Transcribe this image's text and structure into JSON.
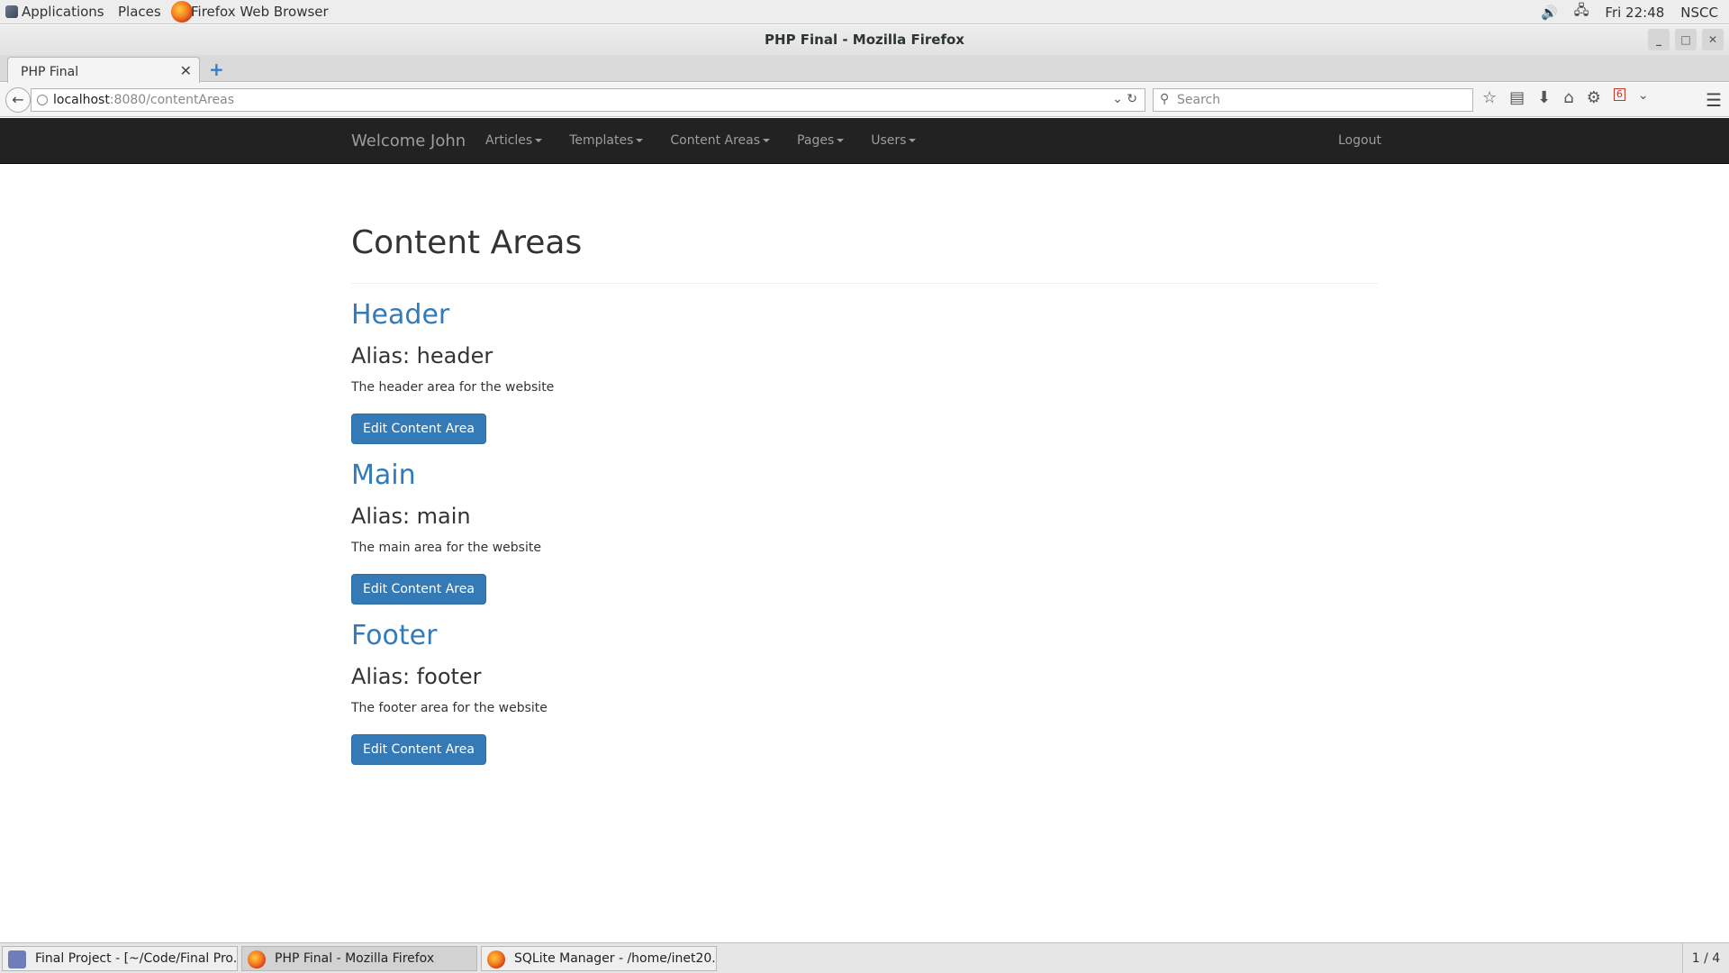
{
  "system_bar": {
    "applications": "Applications",
    "places": "Places",
    "active_app": "Firefox Web Browser",
    "clock": "Fri 22:48",
    "user": "NSCC"
  },
  "window": {
    "title": "PHP Final - Mozilla Firefox"
  },
  "browser": {
    "tab_title": "PHP Final",
    "url_host": "localhost",
    "url_path": ":8080/contentAreas",
    "search_placeholder": "Search",
    "badge_count": "6"
  },
  "site_nav": {
    "brand": "Welcome John",
    "items": [
      {
        "label": "Articles"
      },
      {
        "label": "Templates"
      },
      {
        "label": "Content Areas"
      },
      {
        "label": "Pages"
      },
      {
        "label": "Users"
      }
    ],
    "logout": "Logout"
  },
  "page": {
    "title": "Content Areas",
    "areas": [
      {
        "name": "Header",
        "alias": "Alias: header",
        "description": "The header area for the website",
        "button": "Edit Content Area"
      },
      {
        "name": "Main",
        "alias": "Alias: main",
        "description": "The main area for the website",
        "button": "Edit Content Area"
      },
      {
        "name": "Footer",
        "alias": "Alias: footer",
        "description": "The footer area for the website",
        "button": "Edit Content Area"
      }
    ]
  },
  "taskbar": {
    "tasks": [
      {
        "label": "Final Project - [~/Code/Final Pro..."
      },
      {
        "label": "PHP Final - Mozilla Firefox"
      },
      {
        "label": "SQLite Manager - /home/inet20..."
      }
    ],
    "workspace": "1 / 4"
  }
}
